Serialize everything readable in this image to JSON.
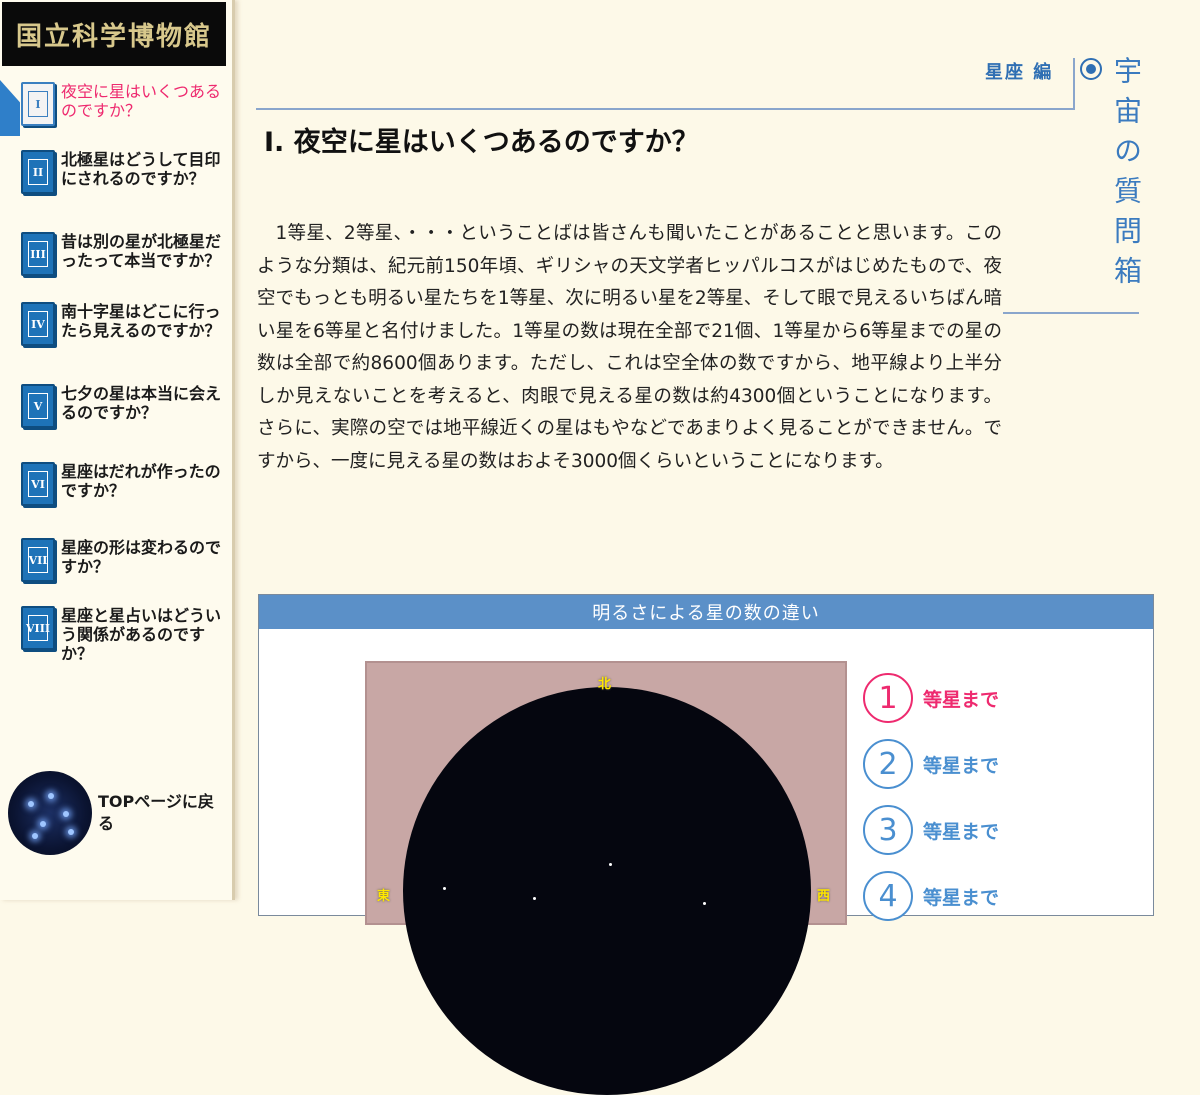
{
  "logo": "国立科学博物館",
  "sidebar": {
    "items": [
      {
        "numeral": "I",
        "label": "夜空に星はいくつあるのですか？",
        "active": true
      },
      {
        "numeral": "II",
        "label": "北極星はどうして目印にされるのですか？"
      },
      {
        "numeral": "III",
        "label": "昔は別の星が北極星だったって本当ですか？"
      },
      {
        "numeral": "IV",
        "label": "南十字星はどこに行ったら見えるのですか？"
      },
      {
        "numeral": "V",
        "label": "七夕の星は本当に会えるのですか？"
      },
      {
        "numeral": "VI",
        "label": "星座はだれが作ったのですか？"
      },
      {
        "numeral": "VII",
        "label": "星座の形は変わるのですか？"
      },
      {
        "numeral": "VIII",
        "label": "星座と星占いはどういう関係があるのですか？"
      }
    ],
    "top_link": "TOPページに戻る"
  },
  "header": {
    "category": "星座 編",
    "vertical_title": "宇宙の質問箱"
  },
  "main": {
    "title": "I. 夜空に星はいくつあるのですか？",
    "body": "1等星、2等星、・・・ということばは皆さんも聞いたことがあることと思います。このような分類は、紀元前150年頃、ギリシャの天文学者ヒッパルコスがはじめたもので、夜空でもっとも明るい星たちを1等星、次に明るい星を2等星、そして眼で見えるいちばん暗い星を6等星と名付けました。1等星の数は現在全部で21個、1等星から6等星までの星の数は全部で約8600個あります。ただし、これは空全体の数ですから、地平線より上半分しか見えないことを考えると、肉眼で見える星の数は約4300個ということになります。さらに、実際の空では地平線近くの星はもやなどであまりよく見ることができません。ですから、一度に見える星の数はおよそ3000個くらいということになります。"
  },
  "figure": {
    "caption": "明るさによる星の数の違い",
    "compass": {
      "north": "北",
      "east": "東",
      "west": "西"
    },
    "legend": [
      {
        "num": "1",
        "label": "等星まで",
        "active": true
      },
      {
        "num": "2",
        "label": "等星まで"
      },
      {
        "num": "3",
        "label": "等星まで"
      },
      {
        "num": "4",
        "label": "等星まで"
      }
    ]
  },
  "colors": {
    "accent_blue": "#2f6fb3",
    "active_pink": "#ee2a6f",
    "caption_bar": "#5b90c8",
    "background": "#fdf9e8"
  }
}
